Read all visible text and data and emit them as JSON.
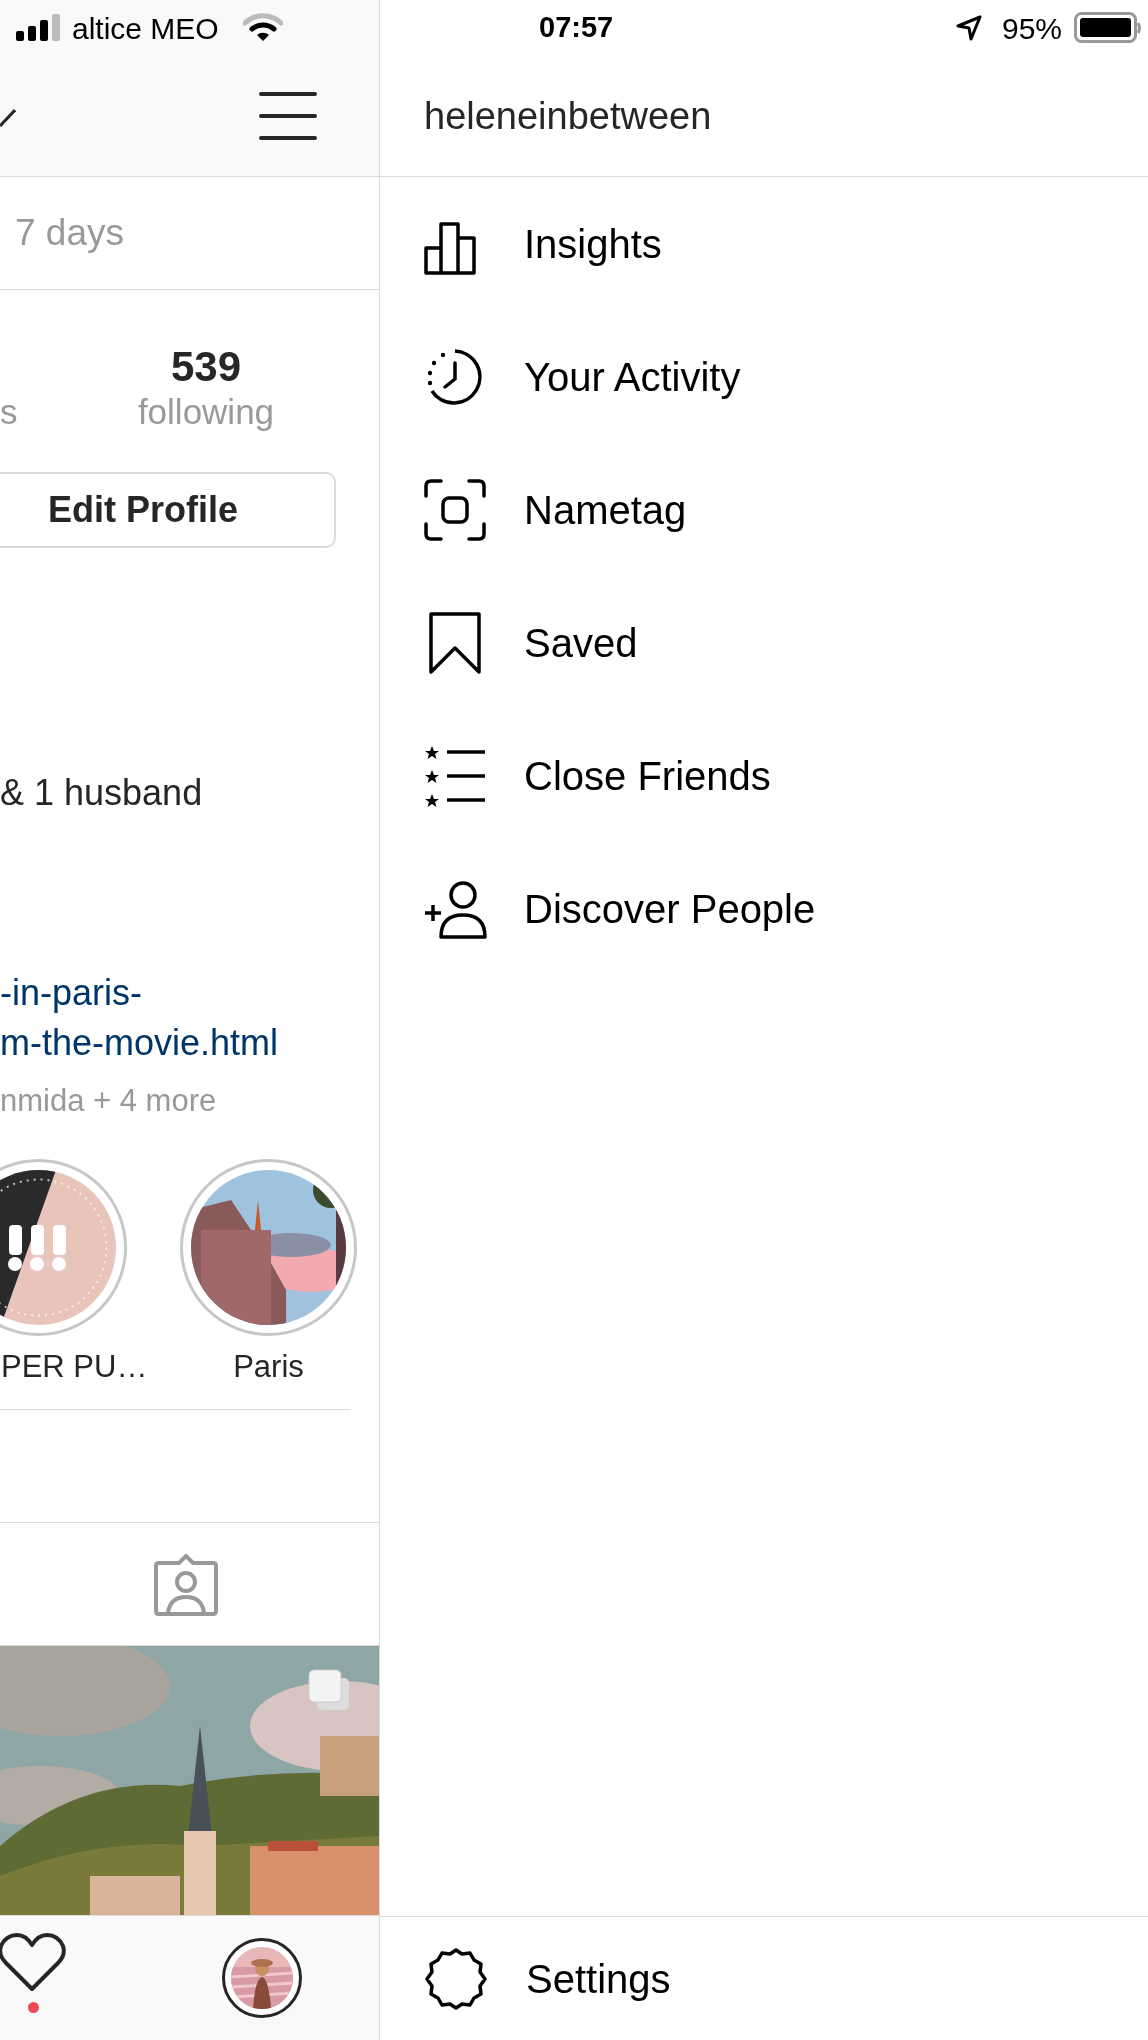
{
  "status_bar": {
    "carrier": "altice MEO",
    "time": "07:57",
    "battery": "95%"
  },
  "profile": {
    "insights_note": "7 days",
    "stats": [
      {
        "label": "s"
      },
      {
        "number": "539",
        "label": "following"
      }
    ],
    "edit_button": "Edit Profile",
    "bio_line": "& 1 husband",
    "link_lines": [
      "-in-paris-",
      "m-the-movie.html"
    ],
    "followed_by": "nmida + 4 more",
    "highlights": [
      {
        "label": "PER PU…",
        "kind": "graphic"
      },
      {
        "label": "Paris",
        "kind": "picture"
      }
    ]
  },
  "bottom_nav": {
    "activity_notification": true
  },
  "menu": {
    "username": "heleneinbetween",
    "items": [
      {
        "label": "Insights",
        "kind": "insights"
      },
      {
        "label": "Your Activity",
        "kind": "activity"
      },
      {
        "label": "Nametag",
        "kind": "nametag"
      },
      {
        "label": "Saved",
        "kind": "saved"
      },
      {
        "label": "Close Friends",
        "kind": "close-friends"
      },
      {
        "label": "Discover People",
        "kind": "discover"
      }
    ],
    "settings": "Settings"
  }
}
